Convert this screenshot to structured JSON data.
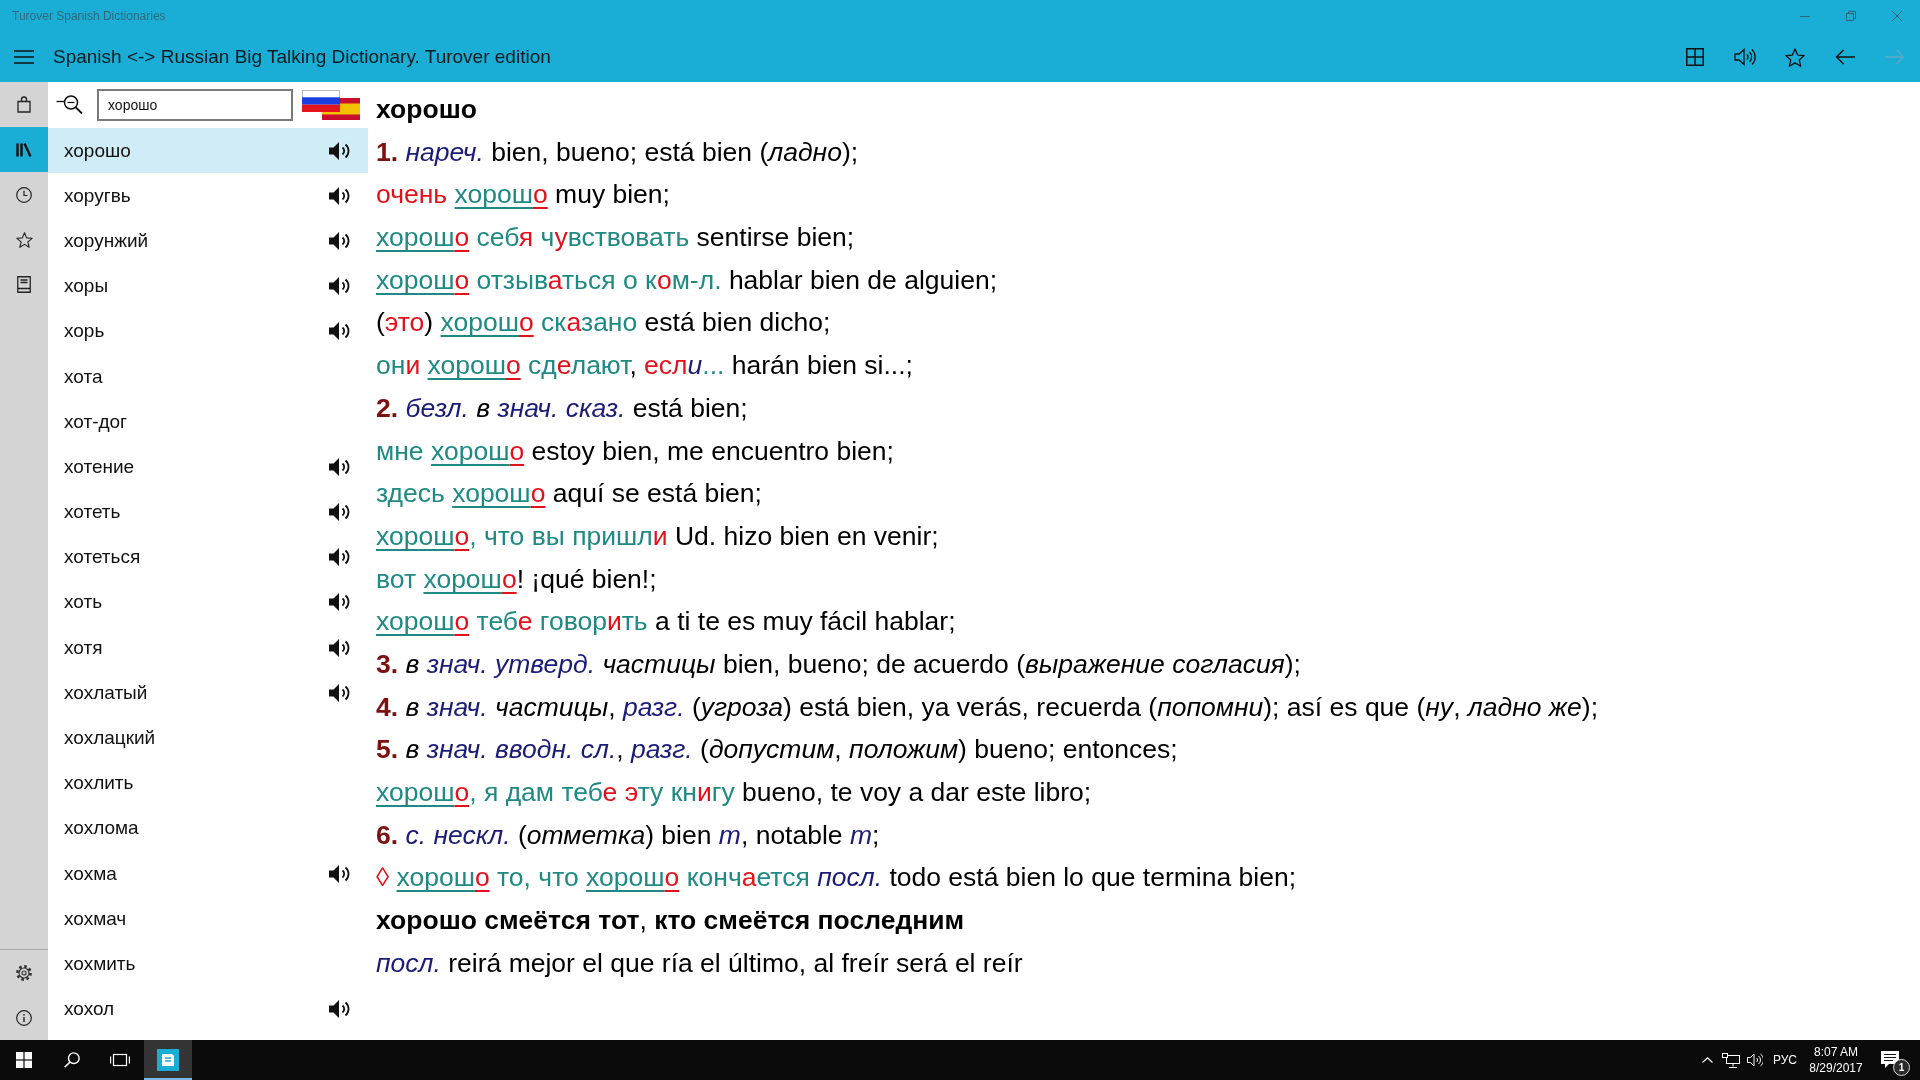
{
  "window": {
    "title": "Turover Spanish Dictionaries"
  },
  "app_bar": {
    "title": "Spanish <-> Russian Big Talking Dictionary. Turover edition",
    "forward_button": {
      "disabled": true
    }
  },
  "nav_rail": {
    "items": [
      {
        "selected": false
      },
      {
        "selected": true
      },
      {
        "selected": false
      },
      {
        "selected": false
      },
      {
        "selected": false
      }
    ]
  },
  "search": {
    "value": "хорошо"
  },
  "word_list": {
    "items": [
      {
        "text": "хорошо",
        "selected": true,
        "audio": true
      },
      {
        "text": "хоругвь",
        "selected": false,
        "audio": true
      },
      {
        "text": "хорунжий",
        "selected": false,
        "audio": true
      },
      {
        "text": "хоры",
        "selected": false,
        "audio": true
      },
      {
        "text": "хорь",
        "selected": false,
        "audio": true
      },
      {
        "text": "хота",
        "selected": false,
        "audio": false
      },
      {
        "text": "хот-дог",
        "selected": false,
        "audio": false
      },
      {
        "text": "хотение",
        "selected": false,
        "audio": true
      },
      {
        "text": "хотеть",
        "selected": false,
        "audio": true
      },
      {
        "text": "хотеться",
        "selected": false,
        "audio": true
      },
      {
        "text": "хоть",
        "selected": false,
        "audio": true
      },
      {
        "text": "хотя",
        "selected": false,
        "audio": true
      },
      {
        "text": "хохлатый",
        "selected": false,
        "audio": true
      },
      {
        "text": "хохлацкий",
        "selected": false,
        "audio": false
      },
      {
        "text": "хохлить",
        "selected": false,
        "audio": false
      },
      {
        "text": "хохлома",
        "selected": false,
        "audio": false
      },
      {
        "text": "хохма",
        "selected": false,
        "audio": true
      },
      {
        "text": "хохмач",
        "selected": false,
        "audio": false
      },
      {
        "text": "хохмить",
        "selected": false,
        "audio": false
      },
      {
        "text": "хохол",
        "selected": false,
        "audio": true
      }
    ]
  },
  "entry": {
    "headword": "хорошо",
    "lines": [
      [
        {
          "kind": "num",
          "text": "1. "
        },
        {
          "kind": "label",
          "text": "нареч."
        },
        {
          "kind": "es",
          "text": " bien, bueno; está bien ("
        },
        {
          "kind": "gloss",
          "text": "ладно"
        },
        {
          "kind": "es",
          "text": ");"
        }
      ],
      [
        {
          "kind": "stress",
          "text": "очень "
        },
        {
          "kind": "link",
          "parts": [
            {
              "kind": "ru",
              "text": "хорош"
            },
            {
              "kind": "stress",
              "text": "о"
            }
          ]
        },
        {
          "kind": "es",
          "text": " muy bien;"
        }
      ],
      [
        {
          "kind": "link",
          "parts": [
            {
              "kind": "ru",
              "text": "хорош"
            },
            {
              "kind": "stress",
              "text": "о"
            }
          ]
        },
        {
          "kind": "ru",
          "text": " себ"
        },
        {
          "kind": "stress",
          "text": "я"
        },
        {
          "kind": "ru",
          "text": " ч"
        },
        {
          "kind": "stress",
          "text": "у"
        },
        {
          "kind": "ru",
          "text": "вствовать"
        },
        {
          "kind": "es",
          "text": " sentirse bien;"
        }
      ],
      [
        {
          "kind": "link",
          "parts": [
            {
              "kind": "ru",
              "text": "хорош"
            },
            {
              "kind": "stress",
              "text": "о"
            }
          ]
        },
        {
          "kind": "ru",
          "text": " отзыв"
        },
        {
          "kind": "stress",
          "text": "а"
        },
        {
          "kind": "ru",
          "text": "ться о к"
        },
        {
          "kind": "stress",
          "text": "о"
        },
        {
          "kind": "ru",
          "text": "м-л."
        },
        {
          "kind": "es",
          "text": " hablar bien de alguien;"
        }
      ],
      [
        {
          "kind": "es",
          "text": "("
        },
        {
          "kind": "stress",
          "text": "это"
        },
        {
          "kind": "es",
          "text": ") "
        },
        {
          "kind": "link",
          "parts": [
            {
              "kind": "ru",
              "text": "хорош"
            },
            {
              "kind": "stress",
              "text": "о"
            }
          ]
        },
        {
          "kind": "ru",
          "text": " ск"
        },
        {
          "kind": "stress",
          "text": "а"
        },
        {
          "kind": "ru",
          "text": "зано"
        },
        {
          "kind": "es",
          "text": " está bien dicho;"
        }
      ],
      [
        {
          "kind": "ru",
          "text": "он"
        },
        {
          "kind": "stress",
          "text": "и "
        },
        {
          "kind": "link",
          "parts": [
            {
              "kind": "ru",
              "text": "хорош"
            },
            {
              "kind": "stress",
              "text": "о"
            }
          ]
        },
        {
          "kind": "ru",
          "text": " сд"
        },
        {
          "kind": "stress",
          "text": "е"
        },
        {
          "kind": "ru",
          "text": "лают"
        },
        {
          "kind": "es",
          "text": ", "
        },
        {
          "kind": "stress",
          "text": "есл"
        },
        {
          "kind": "label",
          "text": "и"
        },
        {
          "kind": "ru",
          "text": "..."
        },
        {
          "kind": "es",
          "text": " harán bien si...;"
        }
      ],
      [
        {
          "kind": "num",
          "text": "2. "
        },
        {
          "kind": "label",
          "text": "безл. "
        },
        {
          "kind": "gloss",
          "text": "в "
        },
        {
          "kind": "label",
          "text": "знач. сказ."
        },
        {
          "kind": "es",
          "text": " está bien;"
        }
      ],
      [
        {
          "kind": "ru",
          "text": "мне "
        },
        {
          "kind": "link",
          "parts": [
            {
              "kind": "ru",
              "text": "хорош"
            },
            {
              "kind": "stress",
              "text": "о"
            }
          ]
        },
        {
          "kind": "es",
          "text": " estoy bien, me encuentro bien;"
        }
      ],
      [
        {
          "kind": "ru",
          "text": "здесь "
        },
        {
          "kind": "link",
          "parts": [
            {
              "kind": "ru",
              "text": "хорош"
            },
            {
              "kind": "stress",
              "text": "о"
            }
          ]
        },
        {
          "kind": "es",
          "text": " aquí se está bien;"
        }
      ],
      [
        {
          "kind": "link",
          "parts": [
            {
              "kind": "ru",
              "text": "хорош"
            },
            {
              "kind": "stress",
              "text": "о"
            }
          ]
        },
        {
          "kind": "ru",
          "text": ", что вы пришл"
        },
        {
          "kind": "stress",
          "text": "и"
        },
        {
          "kind": "es",
          "text": " Ud. hizo bien en venir;"
        }
      ],
      [
        {
          "kind": "ru",
          "text": "вот "
        },
        {
          "kind": "link",
          "parts": [
            {
              "kind": "ru",
              "text": "хорош"
            },
            {
              "kind": "stress",
              "text": "о"
            }
          ]
        },
        {
          "kind": "es",
          "text": "! ¡qué bien!;"
        }
      ],
      [
        {
          "kind": "link",
          "parts": [
            {
              "kind": "ru",
              "text": "хорош"
            },
            {
              "kind": "stress",
              "text": "о"
            }
          ]
        },
        {
          "kind": "ru",
          "text": " теб"
        },
        {
          "kind": "stress",
          "text": "е"
        },
        {
          "kind": "ru",
          "text": " говор"
        },
        {
          "kind": "stress",
          "text": "и"
        },
        {
          "kind": "ru",
          "text": "ть"
        },
        {
          "kind": "es",
          "text": " a ti te es muy fácil hablar;"
        }
      ],
      [
        {
          "kind": "num",
          "text": "3. "
        },
        {
          "kind": "gloss",
          "text": "в "
        },
        {
          "kind": "label",
          "text": "знач. утверд. "
        },
        {
          "kind": "gloss",
          "text": "частицы"
        },
        {
          "kind": "es",
          "text": " bien, bueno; de acuerdo ("
        },
        {
          "kind": "gloss",
          "text": "выражение согласия"
        },
        {
          "kind": "es",
          "text": ");"
        }
      ],
      [
        {
          "kind": "num",
          "text": "4. "
        },
        {
          "kind": "gloss",
          "text": "в "
        },
        {
          "kind": "label",
          "text": "знач. "
        },
        {
          "kind": "gloss",
          "text": "частицы"
        },
        {
          "kind": "es",
          "text": ", "
        },
        {
          "kind": "label",
          "text": "разг."
        },
        {
          "kind": "es",
          "text": " ("
        },
        {
          "kind": "gloss",
          "text": "угроза"
        },
        {
          "kind": "es",
          "text": ") está bien, ya verás, recuerda ("
        },
        {
          "kind": "gloss",
          "text": "попомни"
        },
        {
          "kind": "es",
          "text": "); así es que ("
        },
        {
          "kind": "gloss",
          "text": "ну"
        },
        {
          "kind": "es",
          "text": ", "
        },
        {
          "kind": "gloss",
          "text": "ладно же"
        },
        {
          "kind": "es",
          "text": ");"
        }
      ],
      [
        {
          "kind": "num",
          "text": "5. "
        },
        {
          "kind": "gloss",
          "text": "в "
        },
        {
          "kind": "label",
          "text": "знач. вводн. сл."
        },
        {
          "kind": "es",
          "text": ", "
        },
        {
          "kind": "label",
          "text": "разг."
        },
        {
          "kind": "es",
          "text": " ("
        },
        {
          "kind": "gloss",
          "text": "допустим"
        },
        {
          "kind": "es",
          "text": ", "
        },
        {
          "kind": "gloss",
          "text": "положим"
        },
        {
          "kind": "es",
          "text": ") bueno; entonces;"
        }
      ],
      [
        {
          "kind": "link",
          "parts": [
            {
              "kind": "ru",
              "text": "хорош"
            },
            {
              "kind": "stress",
              "text": "о"
            }
          ]
        },
        {
          "kind": "ru",
          "text": ", я дам теб"
        },
        {
          "kind": "stress",
          "text": "е э"
        },
        {
          "kind": "ru",
          "text": "ту кн"
        },
        {
          "kind": "stress",
          "text": "и"
        },
        {
          "kind": "ru",
          "text": "гу"
        },
        {
          "kind": "es",
          "text": " bueno, te voy a dar este libro;"
        }
      ],
      [
        {
          "kind": "num",
          "text": "6. "
        },
        {
          "kind": "label",
          "text": "с. нескл."
        },
        {
          "kind": "es",
          "text": " ("
        },
        {
          "kind": "gloss",
          "text": "отметка"
        },
        {
          "kind": "es",
          "text": ") bien "
        },
        {
          "kind": "label",
          "text": "m"
        },
        {
          "kind": "es",
          "text": ", notable "
        },
        {
          "kind": "label",
          "text": "m"
        },
        {
          "kind": "es",
          "text": ";"
        }
      ],
      [
        {
          "kind": "stress",
          "text": "◊ "
        },
        {
          "kind": "link",
          "parts": [
            {
              "kind": "ru",
              "text": "хорош"
            },
            {
              "kind": "stress",
              "text": "о"
            }
          ]
        },
        {
          "kind": "ru",
          "text": " то, что "
        },
        {
          "kind": "link",
          "parts": [
            {
              "kind": "ru",
              "text": "хорош"
            },
            {
              "kind": "stress",
              "text": "о"
            }
          ]
        },
        {
          "kind": "ru",
          "text": " конч"
        },
        {
          "kind": "stress",
          "text": "а"
        },
        {
          "kind": "ru",
          "text": "ется "
        },
        {
          "kind": "label",
          "text": "посл."
        },
        {
          "kind": "es",
          "text": " todo está bien lo que termina bien;"
        }
      ],
      [
        {
          "kind": "bold",
          "text": "хорошо смеётся тот"
        },
        {
          "kind": "es",
          "text": ", "
        },
        {
          "kind": "bold",
          "text": "кто смеётся последним"
        }
      ],
      [
        {
          "kind": "label",
          "text": "посл."
        },
        {
          "kind": "es",
          "text": " reirá mejor el que ría el último, al freír será el reír"
        }
      ]
    ]
  },
  "taskbar": {
    "language": "РУС",
    "time": "8:07 AM",
    "date": "8/29/2017",
    "notification_count": "1"
  }
}
